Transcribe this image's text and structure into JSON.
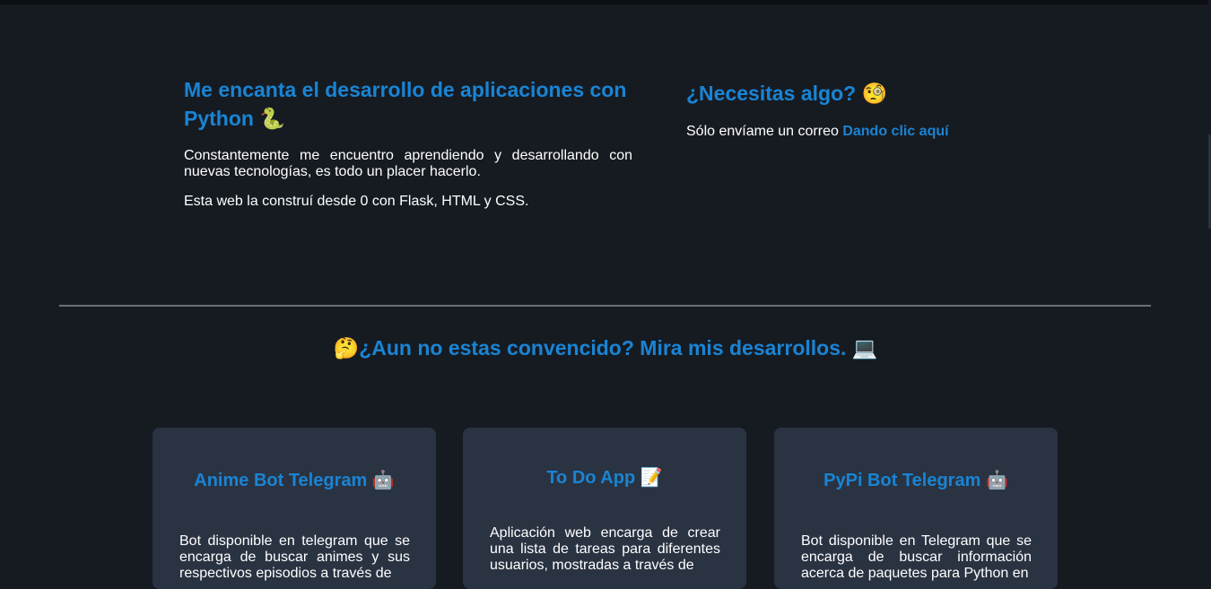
{
  "about": {
    "title": "Me encanta el desarrollo de aplicaciones con Python",
    "title_emoji": "🐍",
    "p1": "Constantemente me encuentro aprendiendo y desarrollando con nuevas tecnologías, es todo un placer hacerlo.",
    "p2": "Esta web la construí desde 0 con Flask, HTML y CSS."
  },
  "contact": {
    "title": "¿Necesitas algo?",
    "title_emoji": "🧐",
    "text": "Sólo envíame un correo",
    "link": "Dando clic aquí"
  },
  "projects": {
    "title_emoji_left": "🤔",
    "title": "¿Aun no estas convencido? Mira mis desarrollos.",
    "title_emoji_right": "💻",
    "cards": [
      {
        "title": "Anime Bot Telegram",
        "emoji": "🤖",
        "description": "Bot disponible en telegram que se encarga de buscar animes y sus respectivos episodios a través de"
      },
      {
        "title": "To Do App",
        "emoji": "📝",
        "description": "Aplicación web encarga de crear una lista de tareas para diferentes usuarios, mostradas a través de"
      },
      {
        "title": "PyPi Bot Telegram",
        "emoji": "🤖",
        "description": "Bot disponible en Telegram que se encarga de buscar información acerca de paquetes para Python en"
      }
    ]
  },
  "colors": {
    "background": "#161b22",
    "accent": "#1a84d4",
    "card": "#2a3342"
  }
}
